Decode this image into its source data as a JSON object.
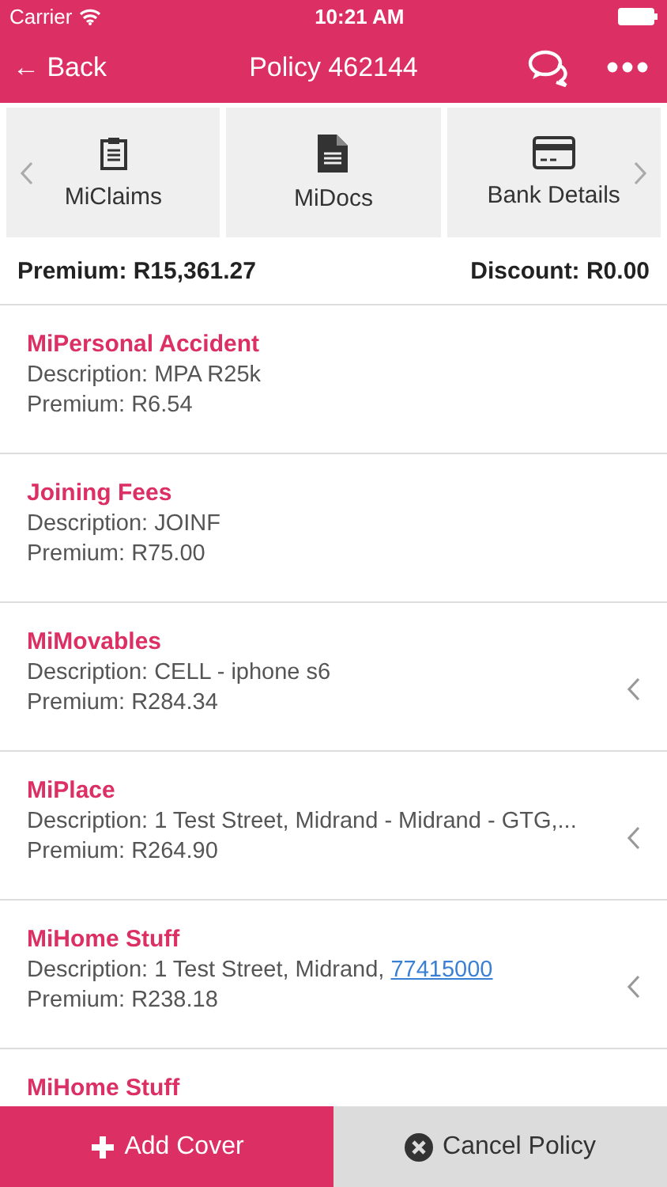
{
  "status_bar": {
    "carrier": "Carrier",
    "time": "10:21 AM"
  },
  "nav": {
    "back": "← Back",
    "title": "Policy 462144"
  },
  "tiles": [
    {
      "label": "MiClaims"
    },
    {
      "label": "MiDocs"
    },
    {
      "label": "Bank Details"
    }
  ],
  "summary": {
    "premium": "Premium: R15,361.27",
    "discount": "Discount: R0.00"
  },
  "covers": [
    {
      "title": "MiPersonal Accident",
      "description": "Description: MPA R25k",
      "premium": "Premium: R6.54",
      "expandable": false
    },
    {
      "title": "Joining Fees",
      "description": "Description: JOINF",
      "premium": "Premium: R75.00",
      "expandable": false
    },
    {
      "title": "MiMovables",
      "description": "Description: CELL - iphone s6",
      "premium": "Premium: R284.34",
      "expandable": true
    },
    {
      "title": "MiPlace",
      "description": "Description: 1 Test Street, Midrand - Midrand - GTG,...",
      "premium": "Premium: R264.90",
      "expandable": true
    },
    {
      "title": "MiHome Stuff",
      "description": "Description: 1 Test Street, Midrand,",
      "link": "77415000",
      "premium": "Premium: R238.18",
      "expandable": true
    },
    {
      "title": "MiHome Stuff"
    }
  ],
  "footer": {
    "add": "Add Cover",
    "cancel": "Cancel Policy"
  }
}
